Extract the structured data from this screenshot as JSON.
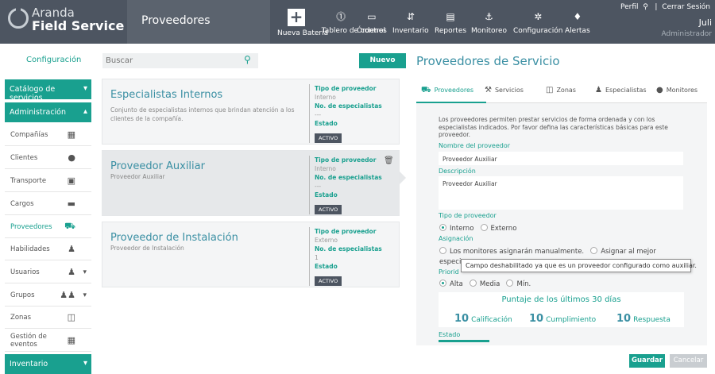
{
  "app": {
    "brand_line1": "Aranda",
    "brand_line2": "Field Service",
    "module": "Proveedores"
  },
  "topnav": [
    {
      "label": "Nueva Batería",
      "icon": "plus-icon"
    },
    {
      "label": "Tablero de control",
      "icon": "dashboard-icon"
    },
    {
      "label": "Órdenes",
      "icon": "orders-icon"
    },
    {
      "label": "Inventario",
      "icon": "inventory-icon"
    },
    {
      "label": "Reportes",
      "icon": "reports-icon"
    },
    {
      "label": "Monitoreo",
      "icon": "monitor-icon"
    },
    {
      "label": "Configuración",
      "icon": "gear-icon"
    },
    {
      "label": "Alertas",
      "icon": "bell-icon"
    }
  ],
  "user": {
    "profile": "Perfil",
    "logout": "Cerrar Sesión",
    "name": "Juli",
    "role": "Administrador"
  },
  "sidebar": {
    "title": "Configuración",
    "catalog": "Catálogo de servicios",
    "admin": "Administración",
    "items": [
      {
        "label": "Compañías",
        "icon": "building-icon"
      },
      {
        "label": "Clientes",
        "icon": "person-icon"
      },
      {
        "label": "Transporte",
        "icon": "bus-icon"
      },
      {
        "label": "Cargos",
        "icon": "briefcase-icon"
      },
      {
        "label": "Proveedores",
        "icon": "cart-icon"
      },
      {
        "label": "Habilidades",
        "icon": "worker-icon"
      },
      {
        "label": "Usuarios",
        "icon": "user-icon"
      },
      {
        "label": "Grupos",
        "icon": "group-icon"
      },
      {
        "label": "Zonas",
        "icon": "map-icon"
      },
      {
        "label": "Gestión de eventos",
        "icon": "calendar-icon"
      }
    ],
    "inventory": "Inventario"
  },
  "list": {
    "search_placeholder": "Buscar",
    "new_label": "Nuevo",
    "cards": [
      {
        "title": "Especialistas Internos",
        "desc": "Conjunto de especialistas internos que brindan atención a los clientes de la compañía.",
        "type_label": "Tipo de proveedor",
        "type": "Interno",
        "count_label": "No. de especialistas",
        "count": "---",
        "state_label": "Estado",
        "state": "ACTIVO"
      },
      {
        "title": "Proveedor Auxiliar",
        "desc": "Proveedor Auxiliar",
        "type_label": "Tipo de proveedor",
        "type": "Interno",
        "count_label": "No. de especialistas",
        "count": "---",
        "state_label": "Estado",
        "state": "ACTIVO"
      },
      {
        "title": "Proveedor de Instalación",
        "desc": "Proveedor de Instalación",
        "type_label": "Tipo de proveedor",
        "type": "Externo",
        "count_label": "No. de especialistas",
        "count": "1",
        "state_label": "Estado",
        "state": "ACTIVO"
      }
    ]
  },
  "detail": {
    "title": "Proveedores de Servicio",
    "tabs": [
      {
        "label": "Proveedores",
        "icon": "cart-icon"
      },
      {
        "label": "Servicios",
        "icon": "services-icon"
      },
      {
        "label": "Zonas",
        "icon": "map-icon"
      },
      {
        "label": "Especialistas",
        "icon": "worker-icon"
      },
      {
        "label": "Monitores",
        "icon": "person-icon"
      }
    ],
    "intro": "Los proveedores permiten prestar servicios de forma ordenada y con los especialistas indicados. Por favor defina las características básicas para este proveedor.",
    "name_label": "Nombre del proveedor",
    "name_value": "Proveedor Auxiliar",
    "desc_label": "Descripción",
    "desc_value": "Proveedor Auxiliar",
    "type_label": "Tipo de proveedor",
    "type_opts": [
      "Interno",
      "Externo"
    ],
    "assign_label": "Asignación",
    "assign_opt1": "Los monitores asignarán manualmente.",
    "assign_opt2": "Asignar al mejor",
    "assign_cut": "especia",
    "tooltip": "Campo deshabilitado ya que es un proveedor configurado como auxiliar.",
    "priority_label": "Priorid",
    "priority_opts": [
      "Alta",
      "Media",
      "Mín."
    ],
    "score_title": "Puntaje de los últimos 30 días",
    "scores": [
      {
        "num": "10",
        "label": "Calificación"
      },
      {
        "num": "10",
        "label": "Cumplimiento"
      },
      {
        "num": "10",
        "label": "Respuesta"
      }
    ],
    "state_label": "Estado",
    "save": "Guardar",
    "cancel": "Cancelar"
  }
}
